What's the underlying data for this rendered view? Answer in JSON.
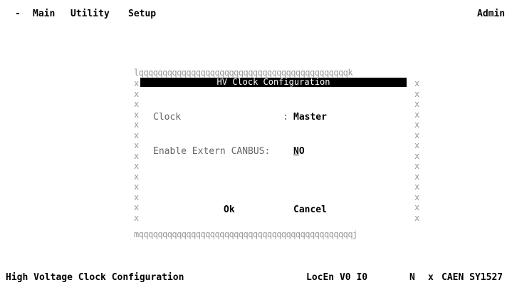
{
  "menu": {
    "dash": "-",
    "items": [
      "Main",
      "Utility",
      "Setup"
    ],
    "user": "Admin"
  },
  "dialog": {
    "title": "HV Clock Configuration",
    "top_border": "lqqqqqqqqqqqqqqqqqqqqqqqqqqqqqqqqqqqqqqqqqqqqk",
    "bottom_border": "mqqqqqqqqqqqqqqqqqqqqqqqqqqqqqqqqqqqqqqqqqqqqqj",
    "side_char": "x",
    "fields": [
      {
        "label": "Clock",
        "sep": ":",
        "value": "Master"
      },
      {
        "label": "Enable Extern CANBUS:",
        "sep": "",
        "value_first": "N",
        "value_rest": "O"
      }
    ],
    "ok_label": "Ok",
    "cancel_label": "Cancel"
  },
  "statusbar": {
    "description": "High Voltage Clock Configuration",
    "state": "LocEn V0 I0",
    "flag": "N",
    "marker": "x",
    "device": "CAEN SY1527"
  }
}
